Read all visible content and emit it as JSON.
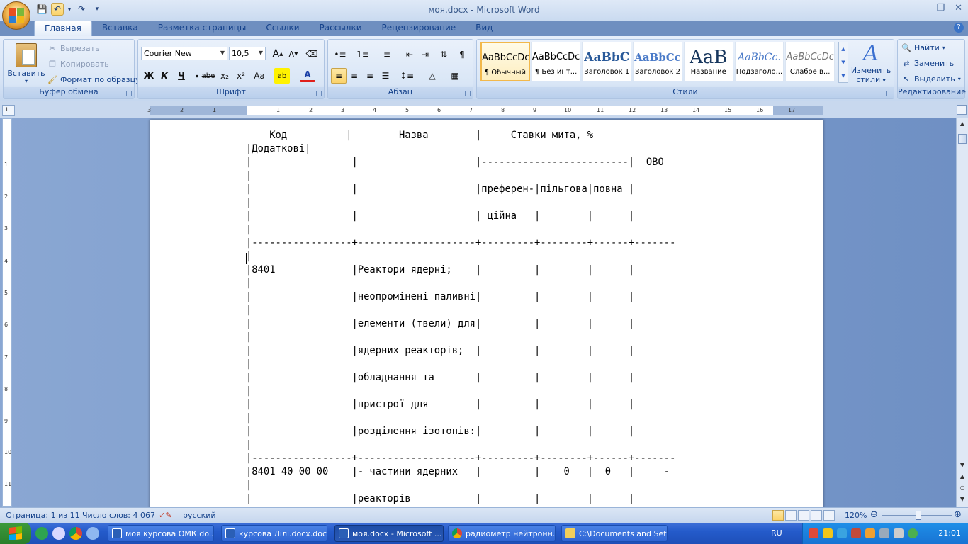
{
  "window": {
    "title": "моя.docx - Microsoft Word"
  },
  "tabs": [
    "Главная",
    "Вставка",
    "Разметка страницы",
    "Ссылки",
    "Рассылки",
    "Рецензирование",
    "Вид"
  ],
  "clipboard": {
    "paste": "Вставить",
    "cut": "Вырезать",
    "copy": "Копировать",
    "format_painter": "Формат по образцу",
    "label": "Буфер обмена"
  },
  "font": {
    "family": "Courier New",
    "size": "10,5",
    "label": "Шрифт",
    "bold": "Ж",
    "italic": "К",
    "underline": "Ч",
    "strike": "abe",
    "subscript": "x₂",
    "superscript": "x²",
    "change_case": "Aa",
    "highlight": "ab",
    "color": "A",
    "grow": "A",
    "shrink": "A"
  },
  "paragraph": {
    "label": "Абзац"
  },
  "styles": {
    "label": "Стили",
    "items": [
      {
        "sample": "AaBbCcDc",
        "name": "¶ Обычный"
      },
      {
        "sample": "AaBbCcDc",
        "name": "¶ Без инт..."
      },
      {
        "sample": "AaBbC",
        "name": "Заголовок 1"
      },
      {
        "sample": "AaBbCc",
        "name": "Заголовок 2"
      },
      {
        "sample": "AaB",
        "name": "Название"
      },
      {
        "sample": "AaBbCc.",
        "name": "Подзаголо..."
      },
      {
        "sample": "AaBbCcDc",
        "name": "Слабое в..."
      }
    ],
    "change_line1": "Изменить",
    "change_line2": "стили"
  },
  "editing": {
    "label": "Редактирование",
    "find": "Найти",
    "replace": "Заменить",
    "select": "Выделить"
  },
  "ruler": {
    "numbers": [
      "3",
      "2",
      "1",
      "1",
      "2",
      "3",
      "4",
      "5",
      "6",
      "7",
      "8",
      "9",
      "10",
      "11",
      "12",
      "13",
      "14",
      "15",
      "16",
      "17"
    ]
  },
  "vruler": {
    "numbers": [
      "1",
      "2",
      "3",
      "4",
      "5",
      "6",
      "7",
      "8",
      "9",
      "10",
      "11"
    ]
  },
  "document": {
    "lines": [
      "    Код          |        Назва        |     Ставки мита, %",
      "|Додаткові|",
      "|                 |                    |-------------------------|  ОВО",
      "|",
      "|                 |                    |преферен-|пільгова|повна |",
      "|",
      "|                 |                    | ційна   |        |      |",
      "|",
      "|-----------------+--------------------+---------+--------+------+-------",
      "|",
      "|8401             |Реактори ядерні;    |         |        |      |",
      "|",
      "|                 |неопромінені паливні|         |        |      |",
      "|",
      "|                 |елементи (твели) для|         |        |      |",
      "|",
      "|                 |ядерних реакторів;  |         |        |      |",
      "|",
      "|                 |обладнання та       |         |        |      |",
      "|",
      "|                 |пристрої для        |         |        |      |",
      "|",
      "|                 |розділення ізотопів:|         |        |      |",
      "|",
      "|-----------------+--------------------+---------+--------+------+-------",
      "|8401 40 00 00    |- частини ядерних   |         |    0   |  0   |     -",
      "|",
      "|                 |реакторів           |         |        |      |"
    ]
  },
  "status": {
    "page": "Страница: 1 из 11",
    "words": "Число слов: 4 067",
    "language": "русский",
    "zoom": "120%"
  },
  "taskbar": {
    "items": [
      "моя курсова ОМК.do...",
      "курсова Лілі.docx.doc...",
      "моя.docx - Microsoft ...",
      "радиометр нейтронн...",
      "C:\\Documents and Set..."
    ],
    "lang": "RU",
    "time": "21:01"
  }
}
